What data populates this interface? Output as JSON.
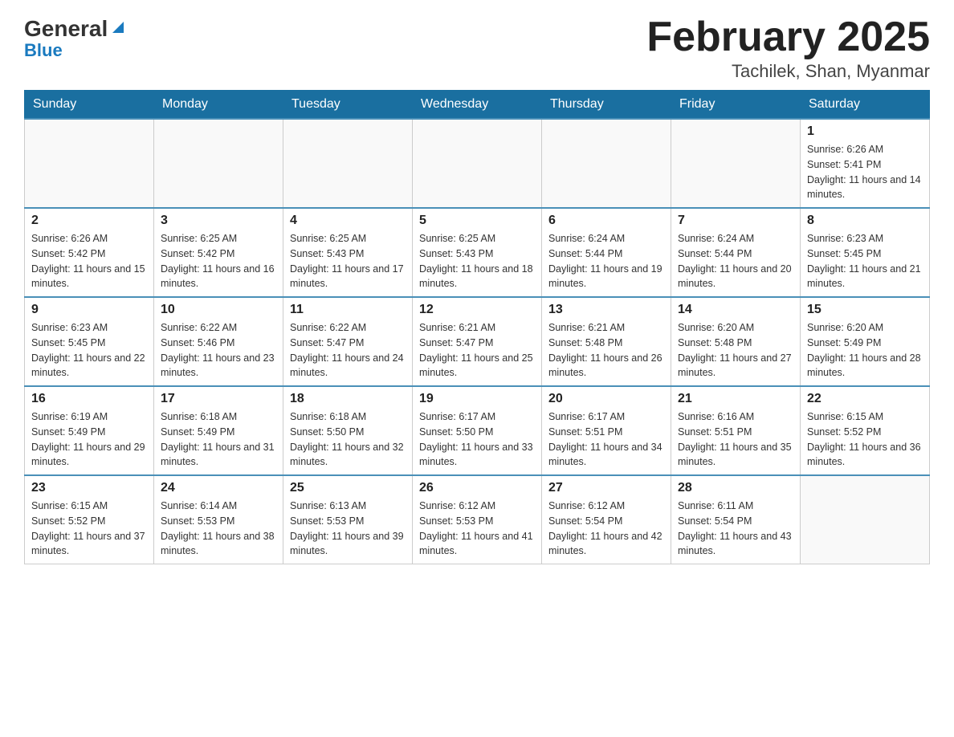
{
  "header": {
    "logo_general": "General",
    "logo_blue": "Blue",
    "month_title": "February 2025",
    "location": "Tachilek, Shan, Myanmar"
  },
  "days_of_week": [
    "Sunday",
    "Monday",
    "Tuesday",
    "Wednesday",
    "Thursday",
    "Friday",
    "Saturday"
  ],
  "weeks": [
    {
      "days": [
        {
          "num": "",
          "info": ""
        },
        {
          "num": "",
          "info": ""
        },
        {
          "num": "",
          "info": ""
        },
        {
          "num": "",
          "info": ""
        },
        {
          "num": "",
          "info": ""
        },
        {
          "num": "",
          "info": ""
        },
        {
          "num": "1",
          "info": "Sunrise: 6:26 AM\nSunset: 5:41 PM\nDaylight: 11 hours and 14 minutes."
        }
      ]
    },
    {
      "days": [
        {
          "num": "2",
          "info": "Sunrise: 6:26 AM\nSunset: 5:42 PM\nDaylight: 11 hours and 15 minutes."
        },
        {
          "num": "3",
          "info": "Sunrise: 6:25 AM\nSunset: 5:42 PM\nDaylight: 11 hours and 16 minutes."
        },
        {
          "num": "4",
          "info": "Sunrise: 6:25 AM\nSunset: 5:43 PM\nDaylight: 11 hours and 17 minutes."
        },
        {
          "num": "5",
          "info": "Sunrise: 6:25 AM\nSunset: 5:43 PM\nDaylight: 11 hours and 18 minutes."
        },
        {
          "num": "6",
          "info": "Sunrise: 6:24 AM\nSunset: 5:44 PM\nDaylight: 11 hours and 19 minutes."
        },
        {
          "num": "7",
          "info": "Sunrise: 6:24 AM\nSunset: 5:44 PM\nDaylight: 11 hours and 20 minutes."
        },
        {
          "num": "8",
          "info": "Sunrise: 6:23 AM\nSunset: 5:45 PM\nDaylight: 11 hours and 21 minutes."
        }
      ]
    },
    {
      "days": [
        {
          "num": "9",
          "info": "Sunrise: 6:23 AM\nSunset: 5:45 PM\nDaylight: 11 hours and 22 minutes."
        },
        {
          "num": "10",
          "info": "Sunrise: 6:22 AM\nSunset: 5:46 PM\nDaylight: 11 hours and 23 minutes."
        },
        {
          "num": "11",
          "info": "Sunrise: 6:22 AM\nSunset: 5:47 PM\nDaylight: 11 hours and 24 minutes."
        },
        {
          "num": "12",
          "info": "Sunrise: 6:21 AM\nSunset: 5:47 PM\nDaylight: 11 hours and 25 minutes."
        },
        {
          "num": "13",
          "info": "Sunrise: 6:21 AM\nSunset: 5:48 PM\nDaylight: 11 hours and 26 minutes."
        },
        {
          "num": "14",
          "info": "Sunrise: 6:20 AM\nSunset: 5:48 PM\nDaylight: 11 hours and 27 minutes."
        },
        {
          "num": "15",
          "info": "Sunrise: 6:20 AM\nSunset: 5:49 PM\nDaylight: 11 hours and 28 minutes."
        }
      ]
    },
    {
      "days": [
        {
          "num": "16",
          "info": "Sunrise: 6:19 AM\nSunset: 5:49 PM\nDaylight: 11 hours and 29 minutes."
        },
        {
          "num": "17",
          "info": "Sunrise: 6:18 AM\nSunset: 5:49 PM\nDaylight: 11 hours and 31 minutes."
        },
        {
          "num": "18",
          "info": "Sunrise: 6:18 AM\nSunset: 5:50 PM\nDaylight: 11 hours and 32 minutes."
        },
        {
          "num": "19",
          "info": "Sunrise: 6:17 AM\nSunset: 5:50 PM\nDaylight: 11 hours and 33 minutes."
        },
        {
          "num": "20",
          "info": "Sunrise: 6:17 AM\nSunset: 5:51 PM\nDaylight: 11 hours and 34 minutes."
        },
        {
          "num": "21",
          "info": "Sunrise: 6:16 AM\nSunset: 5:51 PM\nDaylight: 11 hours and 35 minutes."
        },
        {
          "num": "22",
          "info": "Sunrise: 6:15 AM\nSunset: 5:52 PM\nDaylight: 11 hours and 36 minutes."
        }
      ]
    },
    {
      "days": [
        {
          "num": "23",
          "info": "Sunrise: 6:15 AM\nSunset: 5:52 PM\nDaylight: 11 hours and 37 minutes."
        },
        {
          "num": "24",
          "info": "Sunrise: 6:14 AM\nSunset: 5:53 PM\nDaylight: 11 hours and 38 minutes."
        },
        {
          "num": "25",
          "info": "Sunrise: 6:13 AM\nSunset: 5:53 PM\nDaylight: 11 hours and 39 minutes."
        },
        {
          "num": "26",
          "info": "Sunrise: 6:12 AM\nSunset: 5:53 PM\nDaylight: 11 hours and 41 minutes."
        },
        {
          "num": "27",
          "info": "Sunrise: 6:12 AM\nSunset: 5:54 PM\nDaylight: 11 hours and 42 minutes."
        },
        {
          "num": "28",
          "info": "Sunrise: 6:11 AM\nSunset: 5:54 PM\nDaylight: 11 hours and 43 minutes."
        },
        {
          "num": "",
          "info": ""
        }
      ]
    }
  ]
}
